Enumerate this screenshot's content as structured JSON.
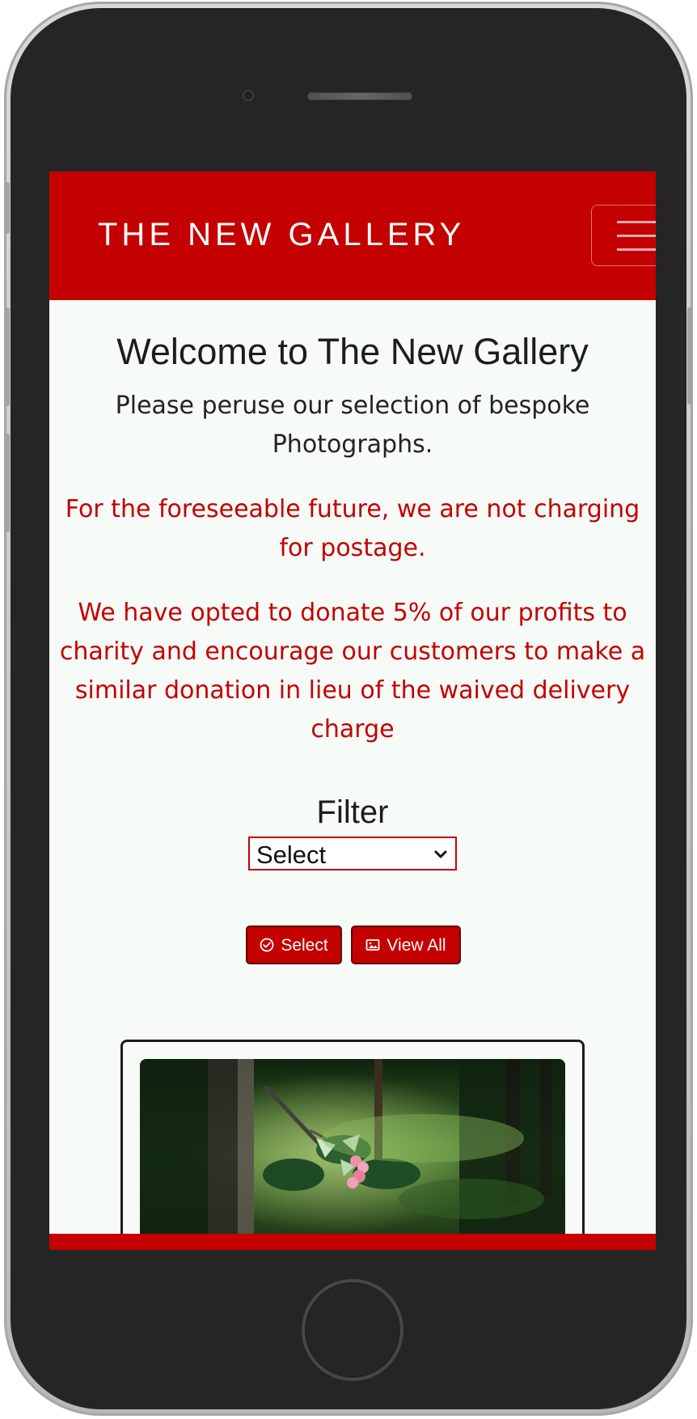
{
  "navbar": {
    "brand": "THE NEW GALLERY"
  },
  "welcome": {
    "title": "Welcome to The New Gallery",
    "intro": "Please peruse our selection of bespoke Photographs.",
    "postage_notice": "For the foreseeable future, we are not charging for postage.",
    "charity_notice": "We have opted to donate 5% of our profits to charity and encourage our customers to make a similar donation in lieu of the waived delivery charge"
  },
  "filter": {
    "title": "Filter",
    "selected": "Select"
  },
  "buttons": {
    "select_label": "Select",
    "view_all_label": "View All"
  },
  "icons": {
    "menu": "hamburger-menu-icon",
    "select": "check-circle-icon",
    "view_all": "image-icon",
    "select_dropdown": "chevron-down-icon"
  },
  "colors": {
    "brand_red": "#c40000",
    "text_dark": "#1d1d1d",
    "page_bg": "#f6fbf8"
  }
}
